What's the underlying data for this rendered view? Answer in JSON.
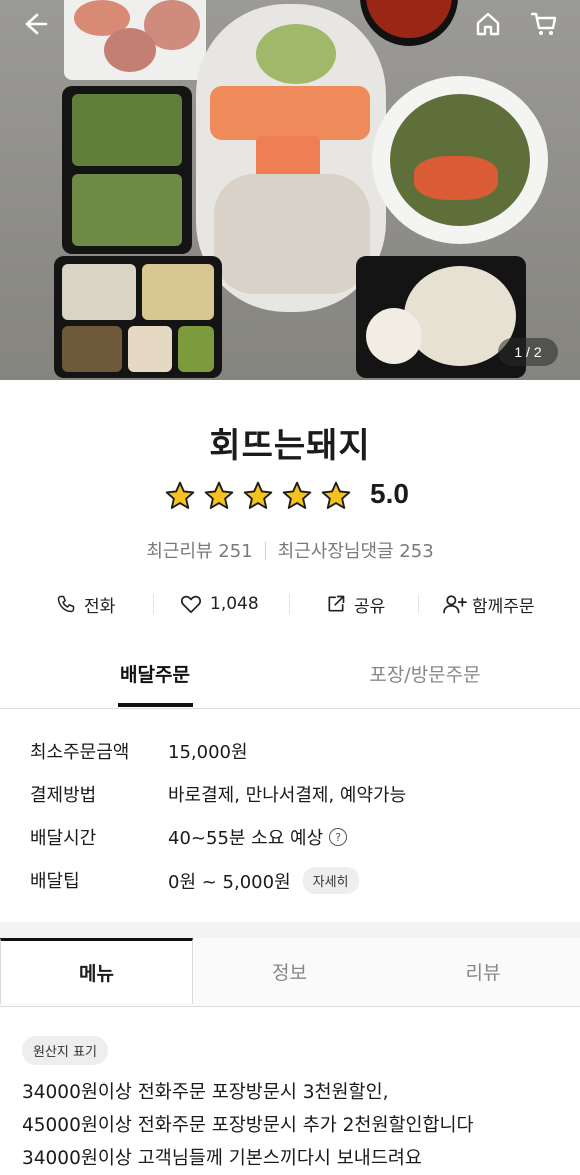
{
  "header": {
    "back_icon": "arrow-left-icon",
    "home_icon": "home-icon",
    "cart_icon": "cart-icon",
    "image_counter": "1 / 2"
  },
  "store": {
    "name": "회뜨는돼지",
    "rating": "5.0",
    "stars": 5,
    "recent_reviews": "최근리뷰 251",
    "owner_comments": "최근사장님댓글 253"
  },
  "actions": {
    "call": "전화",
    "likes": "1,048",
    "share": "공유",
    "group_order": "함께주문"
  },
  "order_tabs": {
    "delivery": "배달주문",
    "pickup": "포장/방문주문"
  },
  "info": {
    "min_order_label": "최소주문금액",
    "min_order_value": "15,000원",
    "payment_label": "결제방법",
    "payment_value": "바로결제, 만나서결제, 예약가능",
    "time_label": "배달시간",
    "time_value": "40~55분 소요 예상",
    "tip_label": "배달팁",
    "tip_value": "0원 ~ 5,000원",
    "tip_detail": "자세히"
  },
  "menu_tabs": {
    "menu": "메뉴",
    "info": "정보",
    "review": "리뷰"
  },
  "origin_badge": "원산지 표기",
  "notice_lines": [
    "34000원이상 전화주문 포장방문시 3천원할인,",
    "45000원이상 전화주문 포장방문시 추가 2천원할인합니다",
    "34000원이상 고객님들께 기본스끼다시 보내드려요"
  ],
  "colors": {
    "star": "#f6c21c",
    "text": "#1b1b1b",
    "muted": "#888888"
  }
}
